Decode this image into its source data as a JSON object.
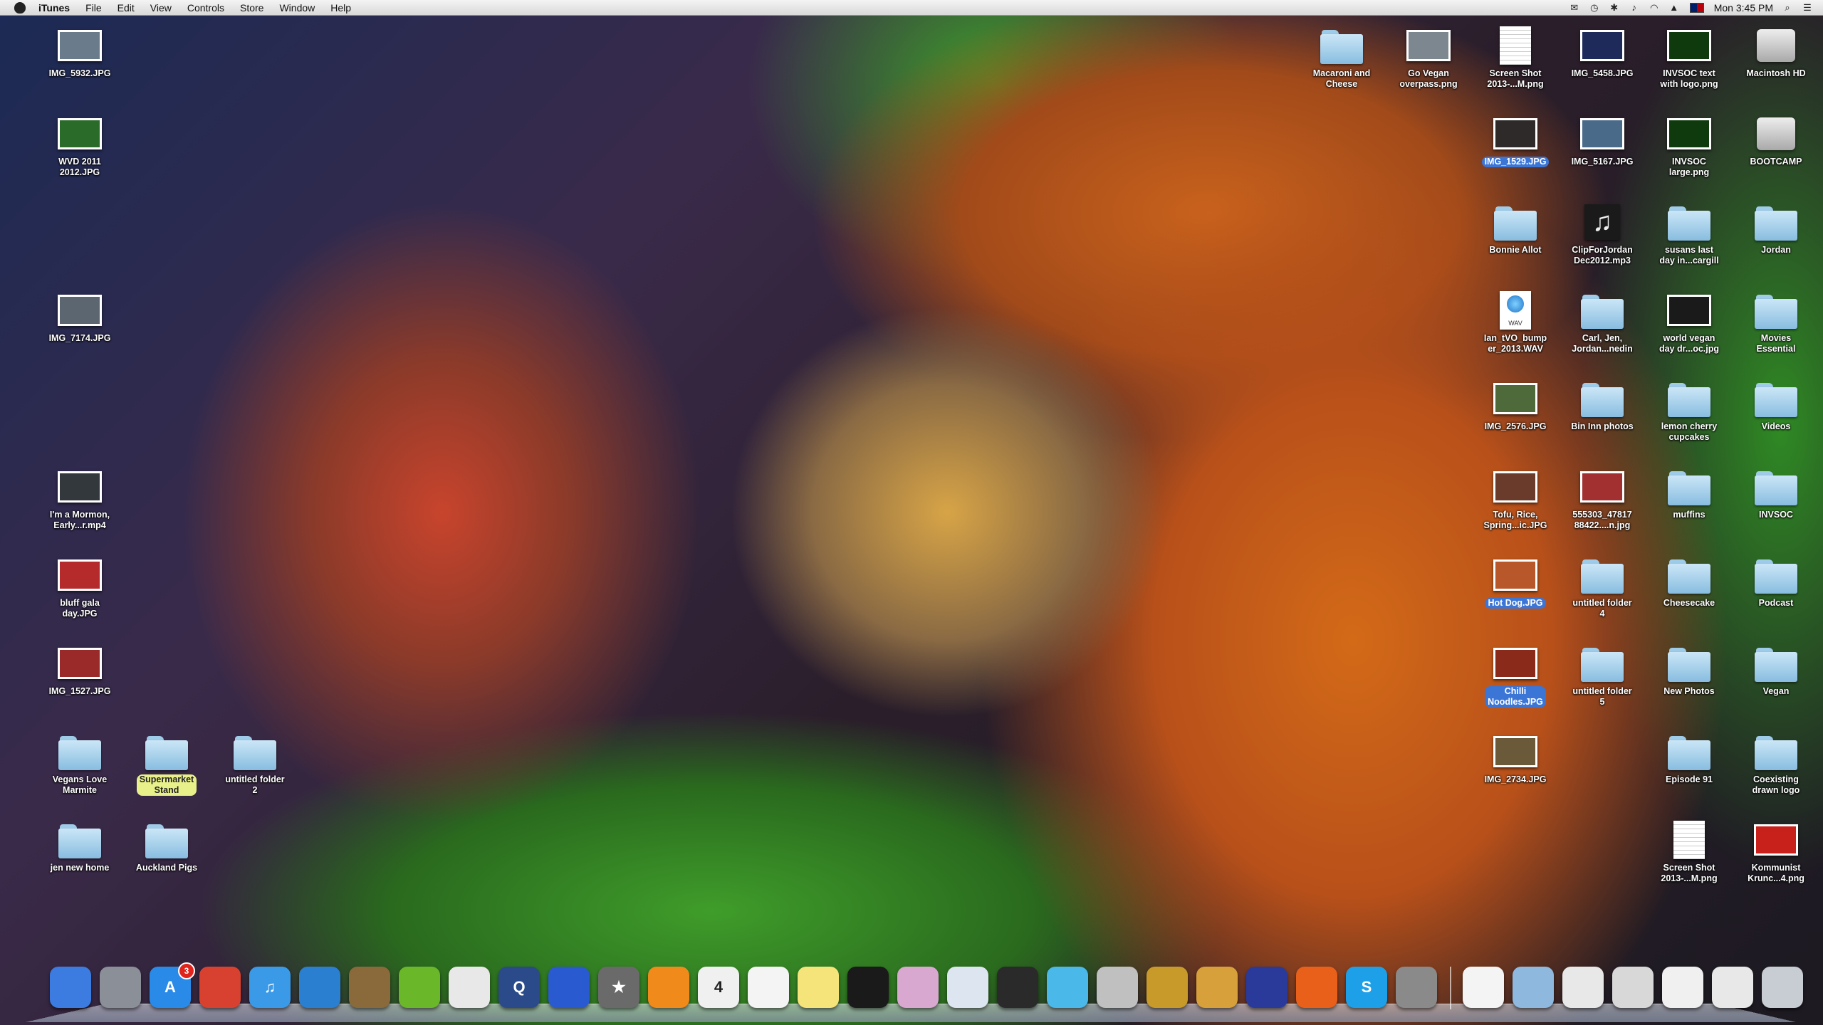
{
  "menubar": {
    "app": "iTunes",
    "items": [
      "File",
      "Edit",
      "View",
      "Controls",
      "Store",
      "Window",
      "Help"
    ],
    "clock": "Mon 3:45 PM"
  },
  "desktop": {
    "left_icons": [
      {
        "label": "IMG_5932.JPG",
        "kind": "img",
        "color": "#6a7b8c"
      },
      {
        "label": "WVD 2011\n2012.JPG",
        "kind": "img",
        "color": "#2a6b2a"
      },
      {
        "label": "IMG_7174.JPG",
        "kind": "img",
        "color": "#5b6670"
      },
      {
        "label": "I'm a Mormon,\nEarly...r.mp4",
        "kind": "img",
        "color": "#33383d"
      },
      {
        "label": "bluff gala\nday.JPG",
        "kind": "img",
        "color": "#b52a2a"
      },
      {
        "label": "IMG_1527.JPG",
        "kind": "img",
        "color": "#9a2a2a"
      },
      {
        "label": "Vegans Love\nMarmite",
        "kind": "folder"
      },
      {
        "label": "Supermarket\nStand",
        "kind": "folder",
        "style": "highlight"
      },
      {
        "label": "untitled folder\n2",
        "kind": "folder"
      },
      {
        "label": "jen new home",
        "kind": "folder"
      },
      {
        "label": "Auckland Pigs",
        "kind": "folder"
      }
    ],
    "right_icons": [
      {
        "label": "Macaroni and\nCheese",
        "kind": "folder"
      },
      {
        "label": "Go Vegan\noverpass.png",
        "kind": "img",
        "color": "#7d8790"
      },
      {
        "label": "Screen Shot\n2013-...M.png",
        "kind": "doc"
      },
      {
        "label": "IMG_5458.JPG",
        "kind": "img",
        "color": "#1d2a5a"
      },
      {
        "label": "INVSOC text\nwith logo.png",
        "kind": "img",
        "color": "#0e3a0e"
      },
      {
        "label": "Macintosh HD",
        "kind": "disk"
      },
      {
        "label": "IMG_1529.JPG",
        "kind": "img",
        "color": "#2e2a2a",
        "style": "selected"
      },
      {
        "label": "IMG_5167.JPG",
        "kind": "img",
        "color": "#4a6a8a"
      },
      {
        "label": "INVSOC\nlarge.png",
        "kind": "img",
        "color": "#0e3a0e"
      },
      {
        "label": "BOOTCAMP",
        "kind": "disk"
      },
      {
        "label": "Bonnie Allot",
        "kind": "folder"
      },
      {
        "label": "ClipForJordan\nDec2012.mp3",
        "kind": "music"
      },
      {
        "label": "susans last\nday in...cargill",
        "kind": "folder"
      },
      {
        "label": "Jordan",
        "kind": "folder"
      },
      {
        "label": "Ian_tVO_bump\ner_2013.WAV",
        "kind": "wav"
      },
      {
        "label": "Carl, Jen,\nJordan...nedin",
        "kind": "folder"
      },
      {
        "label": "world vegan\nday dr...oc.jpg",
        "kind": "img",
        "color": "#1a1a1a"
      },
      {
        "label": "Movies\nEssential",
        "kind": "folder"
      },
      {
        "label": "IMG_2576.JPG",
        "kind": "img",
        "color": "#4f6a3a"
      },
      {
        "label": "Bin Inn photos",
        "kind": "folder"
      },
      {
        "label": "lemon cherry\ncupcakes",
        "kind": "folder"
      },
      {
        "label": "Videos",
        "kind": "folder"
      },
      {
        "label": "Tofu, Rice,\nSpring...ic.JPG",
        "kind": "img",
        "color": "#6a3a2a"
      },
      {
        "label": "555303_47817\n88422....n.jpg",
        "kind": "img",
        "color": "#a23030"
      },
      {
        "label": "muffins",
        "kind": "folder"
      },
      {
        "label": "INVSOC",
        "kind": "folder"
      },
      {
        "label": "Hot Dog.JPG",
        "kind": "img",
        "color": "#b8572a",
        "style": "selected"
      },
      {
        "label": "untitled folder\n4",
        "kind": "folder"
      },
      {
        "label": "Cheesecake",
        "kind": "folder"
      },
      {
        "label": "Podcast",
        "kind": "folder"
      },
      {
        "label": "Chilli\nNoodles.JPG",
        "kind": "img",
        "color": "#8a2a1a",
        "style": "selected"
      },
      {
        "label": "untitled folder\n5",
        "kind": "folder"
      },
      {
        "label": "New Photos",
        "kind": "folder"
      },
      {
        "label": "Vegan",
        "kind": "folder"
      },
      {
        "label": "IMG_2734.JPG",
        "kind": "img",
        "color": "#6a5a3a"
      },
      {
        "label": "Episode 91",
        "kind": "folder"
      },
      {
        "label": "Coexisting\ndrawn logo",
        "kind": "folder"
      },
      {
        "label": "Screen Shot\n2013-...M.png",
        "kind": "doc"
      },
      {
        "label": "Kommunist\nKrunc...4.png",
        "kind": "img",
        "color": "#c8201a"
      }
    ]
  },
  "dock": {
    "apps": [
      {
        "name": "finder-icon",
        "color": "#3c7be0",
        "glyph": ""
      },
      {
        "name": "launchpad-icon",
        "color": "#8a8f98",
        "glyph": ""
      },
      {
        "name": "app-store-icon",
        "color": "#2a8ae8",
        "glyph": "A",
        "badge": "3"
      },
      {
        "name": "chrome-icon",
        "color": "#d8412f",
        "glyph": ""
      },
      {
        "name": "itunes-icon",
        "color": "#3a9ae8",
        "glyph": "♫"
      },
      {
        "name": "safari-icon",
        "color": "#2a7fd0",
        "glyph": ""
      },
      {
        "name": "garageband-icon",
        "color": "#8a6a3a",
        "glyph": ""
      },
      {
        "name": "spotify-icon",
        "color": "#6ab82a",
        "glyph": ""
      },
      {
        "name": "textedit-icon",
        "color": "#e8e8e8",
        "glyph": ""
      },
      {
        "name": "quicktime-icon",
        "color": "#2a4a8a",
        "glyph": "Q"
      },
      {
        "name": "cyberduck-icon",
        "color": "#2a5ad0",
        "glyph": ""
      },
      {
        "name": "imovie-icon",
        "color": "#6a6a6a",
        "glyph": "★"
      },
      {
        "name": "vlc-icon",
        "color": "#f08a1a",
        "glyph": ""
      },
      {
        "name": "calendar-icon",
        "color": "#f0f0f0",
        "glyph": "4"
      },
      {
        "name": "reminders-icon",
        "color": "#f4f4f4",
        "glyph": ""
      },
      {
        "name": "stickies-icon",
        "color": "#f4e47a",
        "glyph": ""
      },
      {
        "name": "terminal-icon",
        "color": "#1a1a1a",
        "glyph": ""
      },
      {
        "name": "orb-icon",
        "color": "#d8a8d0",
        "glyph": ""
      },
      {
        "name": "wifi-icon",
        "color": "#dde6f0",
        "glyph": ""
      },
      {
        "name": "activity-monitor-icon",
        "color": "#2a2a2a",
        "glyph": ""
      },
      {
        "name": "fish-icon",
        "color": "#4ab8e8",
        "glyph": ""
      },
      {
        "name": "rapidweaver-icon",
        "color": "#c0c0c0",
        "glyph": ""
      },
      {
        "name": "pineapple-icon",
        "color": "#c89a2a",
        "glyph": ""
      },
      {
        "name": "pages-icon",
        "color": "#d8a03a",
        "glyph": ""
      },
      {
        "name": "headphones-icon",
        "color": "#2a3a9a",
        "glyph": ""
      },
      {
        "name": "audacity-icon",
        "color": "#e8601a",
        "glyph": ""
      },
      {
        "name": "skype-icon",
        "color": "#1ea0e8",
        "glyph": "S"
      },
      {
        "name": "system-preferences-icon",
        "color": "#8a8a8a",
        "glyph": ""
      }
    ],
    "stacks": [
      {
        "name": "document-stack-icon",
        "color": "#f4f4f4"
      },
      {
        "name": "applications-stack-icon",
        "color": "#8fb8de"
      },
      {
        "name": "screenshot-stack-icon",
        "color": "#e8e8e8"
      },
      {
        "name": "image-stack-icon",
        "color": "#d8d8d8"
      },
      {
        "name": "skype-stack-icon",
        "color": "#f0f0f0"
      },
      {
        "name": "downloads-stack-icon",
        "color": "#e8e8e8"
      },
      {
        "name": "trash-icon",
        "color": "#c8cdd3"
      }
    ]
  }
}
